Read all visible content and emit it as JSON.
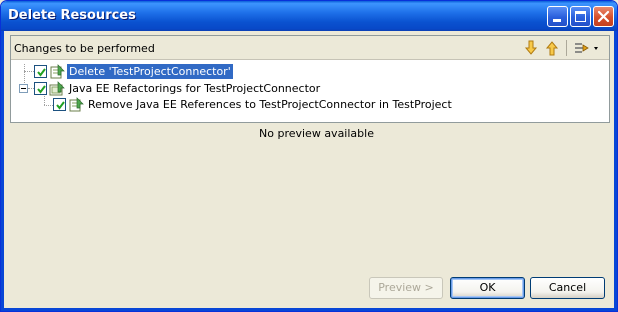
{
  "window": {
    "title": "Delete Resources"
  },
  "changes_panel": {
    "title": "Changes to be performed",
    "toolbar": {
      "next_icon": "arrow-down-icon",
      "previous_icon": "arrow-up-icon",
      "filter_icon": "filter-dropdown-icon"
    }
  },
  "tree": {
    "items": [
      {
        "label": "Delete 'TestProjectConnector'",
        "checked": true,
        "selected": true,
        "level": 0
      },
      {
        "label": "Java EE Refactorings for TestProjectConnector",
        "checked": true,
        "selected": false,
        "level": 0,
        "expanded": true
      },
      {
        "label": "Remove Java EE References to TestProjectConnector in TestProject",
        "checked": true,
        "selected": false,
        "level": 1
      }
    ]
  },
  "preview": {
    "message": "No preview available"
  },
  "buttons": {
    "preview_label": "Preview >",
    "ok_label": "OK",
    "cancel_label": "Cancel"
  },
  "colors": {
    "titlebar": "#0a52d0",
    "selection": "#316ac5",
    "dialog_bg": "#ece9d8"
  }
}
